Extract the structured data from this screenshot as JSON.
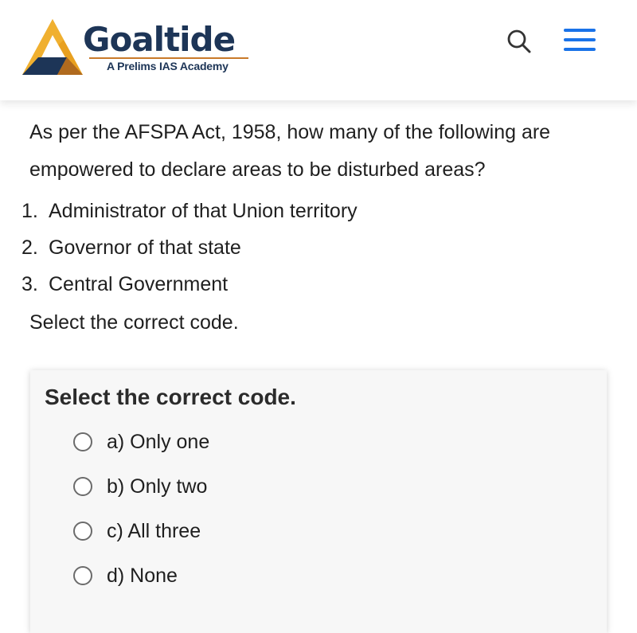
{
  "header": {
    "brand_name": "Goaltide",
    "tagline": "A Prelims IAS Academy",
    "search_icon": "search-icon",
    "menu_icon": "hamburger-menu-icon",
    "accent_color": "#1a73e8",
    "brand_orange": "#e8a020",
    "brand_navy": "#1d3557"
  },
  "question": {
    "text_line1": "As per the AFSPA Act, 1958, how many of the following are",
    "text_line2": "empowered to declare areas to be disturbed areas?",
    "statements": [
      {
        "number": "1.",
        "text": "Administrator of that Union territory"
      },
      {
        "number": "2.",
        "text": "Governor of that state"
      },
      {
        "number": "3.",
        "text": "Central Government"
      }
    ],
    "instruction": "Select the correct code."
  },
  "quiz": {
    "prompt": "Select the correct code.",
    "options": [
      {
        "label": "a) Only one",
        "selected": false
      },
      {
        "label": "b) Only two",
        "selected": false
      },
      {
        "label": "c) All three",
        "selected": false
      },
      {
        "label": "d) None",
        "selected": false
      }
    ]
  }
}
